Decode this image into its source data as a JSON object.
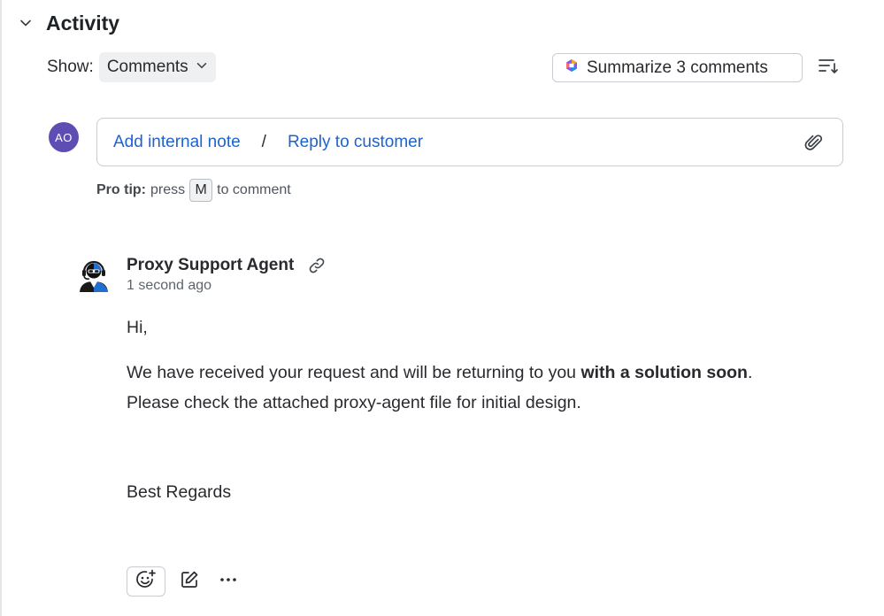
{
  "activity": {
    "title": "Activity",
    "show_label": "Show:",
    "filter_value": "Comments",
    "summarize_label": "Summarize 3 comments"
  },
  "composer": {
    "avatar_initials": "AO",
    "add_note_label": "Add internal note",
    "separator": "/",
    "reply_label": "Reply to customer",
    "tip_prefix": "Pro tip:",
    "tip_press": "press",
    "tip_key": "M",
    "tip_suffix": "to comment"
  },
  "comment": {
    "author": "Proxy Support Agent",
    "timestamp": "1 second ago",
    "greeting": "Hi,",
    "line1_pre": "We have received your request and will be returning to you ",
    "line1_bold": "with a solution soon",
    "line1_post": ".",
    "line2": "Please check the attached proxy-agent file for initial design.",
    "signoff": "Best Regards"
  },
  "icons": {
    "collapse": "chevron-down-icon",
    "dropdown": "chevron-down-icon",
    "ai": "ai-sparkle-icon",
    "sort": "sort-icon",
    "attach": "paperclip-icon",
    "permalink": "link-icon",
    "reaction": "add-reaction-icon",
    "edit": "edit-icon",
    "more": "more-icon"
  },
  "colors": {
    "link": "#1d63cf",
    "avatar": "#5e4db2",
    "text": "#292a2e"
  }
}
